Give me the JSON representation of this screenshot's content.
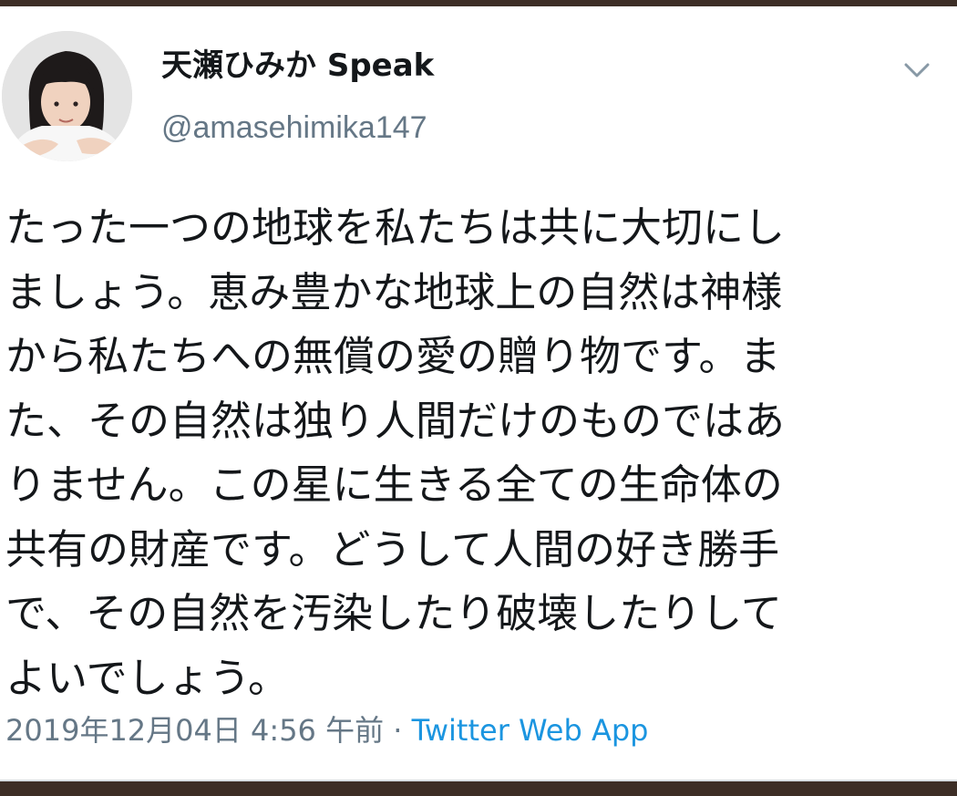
{
  "author": {
    "display_name": "天瀬ひみか Speak",
    "handle": "@amasehimika147"
  },
  "tweet": {
    "lines": [
      "たった一つの地球を私たちは共に大切にし",
      "ましょう。恵み豊かな地球上の自然は神様",
      "から私たちへの無償の愛の贈り物です。ま",
      "た、その自然は独り人間だけのものではあ",
      "りません。この星に生きる全ての生命体の",
      "共有の財産です。どうして人間の好き勝手",
      "で、その自然を汚染したり破壊したりして",
      "よいでしょう。"
    ],
    "timestamp": "2019年12月04日 4:56 午前",
    "separator": " · ",
    "source": "Twitter Web App"
  },
  "icons": {
    "menu": "chevron-down-icon",
    "avatar": "profile-photo"
  },
  "colors": {
    "text_primary": "#14171a",
    "text_secondary": "#657786",
    "link": "#1b95e0",
    "outer_background": "#3d2e26"
  }
}
